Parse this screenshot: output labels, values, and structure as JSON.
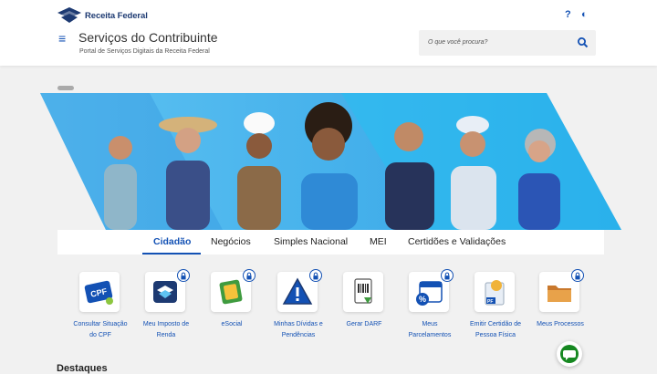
{
  "header": {
    "brand": "Receita Federal",
    "title": "Serviços do Contribuinte",
    "subtitle": "Portal de Serviços Digitais da Receita Federal",
    "help_glyph": "?",
    "contrast_glyph": "◐",
    "search_placeholder": "O que você procura?",
    "menu_glyph": "≡"
  },
  "tabs": [
    {
      "label": "Cidadão",
      "active": true
    },
    {
      "label": "Negócios",
      "active": false
    },
    {
      "label": "Simples Nacional",
      "active": false
    },
    {
      "label": "MEI",
      "active": false
    },
    {
      "label": "Certidões e Validações",
      "active": false
    }
  ],
  "services": [
    {
      "line1": "Consultar Situação",
      "line2": "do CPF",
      "icon": "cpf-card-icon",
      "locked": false
    },
    {
      "line1": "Meu Imposto de",
      "line2": "Renda",
      "icon": "income-tax-icon",
      "locked": true
    },
    {
      "line1": "eSocial",
      "line2": "",
      "icon": "esocial-icon",
      "locked": true
    },
    {
      "line1": "Minhas Dívidas e",
      "line2": "Pendências",
      "icon": "warning-triangle-icon",
      "locked": true
    },
    {
      "line1": "Gerar DARF",
      "line2": "",
      "icon": "darf-document-icon",
      "locked": false
    },
    {
      "line1": "Meus",
      "line2": "Parcelamentos",
      "icon": "calendar-percent-icon",
      "locked": true
    },
    {
      "line1": "Emitir Certidão de",
      "line2": "Pessoa Física",
      "icon": "certificate-icon",
      "locked": false
    },
    {
      "line1": "Meus Processos",
      "line2": "",
      "icon": "folder-icon",
      "locked": true
    }
  ],
  "section": {
    "title": "Destaques"
  },
  "colors": {
    "primary": "#1351b4",
    "brand": "#1d3a72",
    "chat": "#168821",
    "banner": "#35a7e8"
  }
}
